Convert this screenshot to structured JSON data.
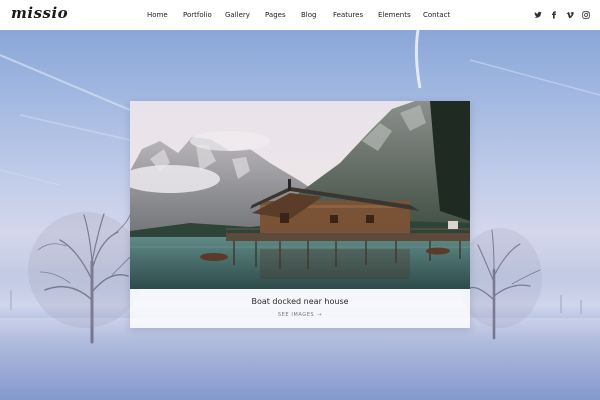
{
  "brand": {
    "logo_text": "missio"
  },
  "nav": {
    "items": [
      {
        "label": "Home"
      },
      {
        "label": "Portfolio"
      },
      {
        "label": "Gallery"
      },
      {
        "label": "Pages"
      },
      {
        "label": "Blog"
      },
      {
        "label": "Features"
      },
      {
        "label": "Elements"
      },
      {
        "label": "Contact"
      }
    ]
  },
  "social": {
    "icons": [
      "twitter-icon",
      "facebook-icon",
      "vimeo-icon",
      "instagram-icon"
    ]
  },
  "card": {
    "title": "Boat docked near house",
    "link_label": "SEE IMAGES",
    "link_arrow": "→"
  },
  "colors": {
    "header_bg": "#ffffff",
    "text_dark": "#222222",
    "link_gray": "#777777",
    "sky_top": "#7e9fd4",
    "ground": "#8fa3d3"
  }
}
